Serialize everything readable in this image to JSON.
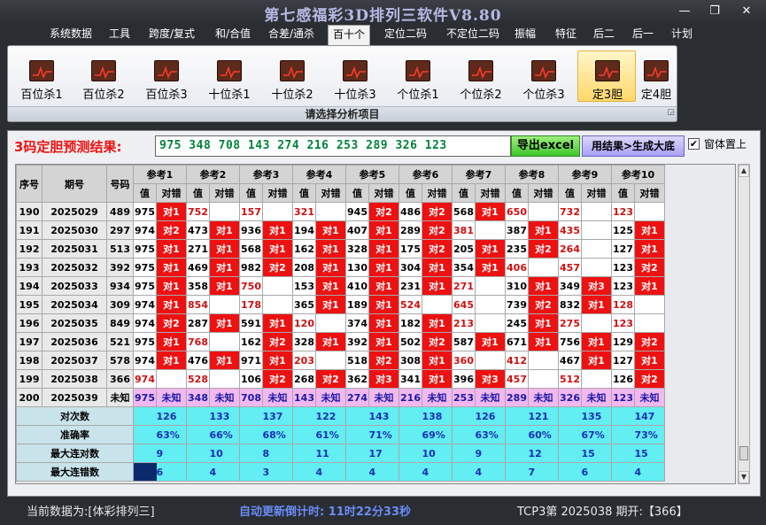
{
  "window": {
    "title": "第七感福彩3D排列三软件V8.80",
    "min_label": "—",
    "max_label": "❐",
    "close_label": "✕"
  },
  "menu": [
    "系统数据",
    "工具",
    "跨度/复式",
    "和/合值",
    "合差/通杀",
    "百十个",
    "定位二码",
    "不定位二码",
    "振幅",
    "特征",
    "后二",
    "后一",
    "计划"
  ],
  "menu_active": "百十个",
  "ribbon": {
    "buttons": [
      "百位杀1",
      "百位杀2",
      "百位杀3",
      "十位杀1",
      "十位杀2",
      "十位杀3",
      "个位杀1",
      "个位杀2",
      "个位杀3",
      "定3胆",
      "定4胆"
    ],
    "selected": "定3胆",
    "footer": "请选择分析项目",
    "icon": "red-line-chart-icon"
  },
  "result": {
    "label": "3码定胆预测结果:",
    "value": "975 348 708 143 274 216 253 289 326 123",
    "export_label": "导出excel",
    "generate_label": "用结果>生成大底",
    "topmost_label": "窗体置上",
    "topmost_checked": true
  },
  "table": {
    "headers": {
      "seq": "序号",
      "period": "期号",
      "number": "号码",
      "value": "值",
      "check": "对错"
    },
    "refs": [
      "参考1",
      "参考2",
      "参考3",
      "参考4",
      "参考5",
      "参考6",
      "参考7",
      "参考8",
      "参考9",
      "参考10"
    ],
    "rows": [
      {
        "seq": "190",
        "period": "2025029",
        "num": "489",
        "cells": [
          [
            "975",
            "对1"
          ],
          [
            "752",
            ""
          ],
          [
            "157",
            ""
          ],
          [
            "321",
            ""
          ],
          [
            "945",
            "对2"
          ],
          [
            "486",
            "对2"
          ],
          [
            "568",
            "对1"
          ],
          [
            "650",
            ""
          ],
          [
            "732",
            ""
          ],
          [
            "123",
            ""
          ]
        ]
      },
      {
        "seq": "191",
        "period": "2025030",
        "num": "297",
        "cells": [
          [
            "974",
            "对2"
          ],
          [
            "473",
            "对1"
          ],
          [
            "936",
            "对1"
          ],
          [
            "194",
            "对1"
          ],
          [
            "407",
            "对1"
          ],
          [
            "289",
            "对2"
          ],
          [
            "381",
            ""
          ],
          [
            "387",
            "对1"
          ],
          [
            "435",
            ""
          ],
          [
            "125",
            "对1"
          ]
        ]
      },
      {
        "seq": "192",
        "period": "2025031",
        "num": "513",
        "cells": [
          [
            "975",
            "对1"
          ],
          [
            "271",
            "对1"
          ],
          [
            "568",
            "对1"
          ],
          [
            "162",
            "对1"
          ],
          [
            "328",
            "对1"
          ],
          [
            "175",
            "对2"
          ],
          [
            "205",
            "对1"
          ],
          [
            "235",
            "对2"
          ],
          [
            "264",
            ""
          ],
          [
            "127",
            "对1"
          ]
        ]
      },
      {
        "seq": "193",
        "period": "2025032",
        "num": "392",
        "cells": [
          [
            "975",
            "对1"
          ],
          [
            "469",
            "对1"
          ],
          [
            "982",
            "对2"
          ],
          [
            "208",
            "对1"
          ],
          [
            "130",
            "对1"
          ],
          [
            "304",
            "对1"
          ],
          [
            "354",
            "对1"
          ],
          [
            "406",
            ""
          ],
          [
            "457",
            ""
          ],
          [
            "123",
            "对2"
          ]
        ]
      },
      {
        "seq": "194",
        "period": "2025033",
        "num": "934",
        "cells": [
          [
            "975",
            "对1"
          ],
          [
            "358",
            "对1"
          ],
          [
            "750",
            ""
          ],
          [
            "153",
            "对1"
          ],
          [
            "410",
            "对1"
          ],
          [
            "231",
            "对1"
          ],
          [
            "271",
            ""
          ],
          [
            "310",
            "对1"
          ],
          [
            "349",
            "对3"
          ],
          [
            "123",
            "对1"
          ]
        ]
      },
      {
        "seq": "195",
        "period": "2025034",
        "num": "309",
        "cells": [
          [
            "974",
            "对1"
          ],
          [
            "854",
            ""
          ],
          [
            "178",
            ""
          ],
          [
            "365",
            "对1"
          ],
          [
            "189",
            "对1"
          ],
          [
            "524",
            ""
          ],
          [
            "645",
            ""
          ],
          [
            "739",
            "对2"
          ],
          [
            "832",
            "对1"
          ],
          [
            "128",
            ""
          ]
        ]
      },
      {
        "seq": "196",
        "period": "2025035",
        "num": "849",
        "cells": [
          [
            "974",
            "对2"
          ],
          [
            "287",
            "对1"
          ],
          [
            "591",
            "对1"
          ],
          [
            "120",
            ""
          ],
          [
            "374",
            "对1"
          ],
          [
            "182",
            "对1"
          ],
          [
            "213",
            ""
          ],
          [
            "245",
            "对1"
          ],
          [
            "275",
            ""
          ],
          [
            "123",
            ""
          ]
        ]
      },
      {
        "seq": "197",
        "period": "2025036",
        "num": "521",
        "cells": [
          [
            "975",
            "对1"
          ],
          [
            "768",
            ""
          ],
          [
            "162",
            "对2"
          ],
          [
            "328",
            "对1"
          ],
          [
            "392",
            "对1"
          ],
          [
            "502",
            "对2"
          ],
          [
            "587",
            "对1"
          ],
          [
            "671",
            "对1"
          ],
          [
            "756",
            "对1"
          ],
          [
            "129",
            "对2"
          ]
        ]
      },
      {
        "seq": "198",
        "period": "2025037",
        "num": "578",
        "cells": [
          [
            "974",
            "对1"
          ],
          [
            "476",
            "对1"
          ],
          [
            "971",
            "对1"
          ],
          [
            "203",
            ""
          ],
          [
            "518",
            "对2"
          ],
          [
            "308",
            "对1"
          ],
          [
            "360",
            ""
          ],
          [
            "412",
            ""
          ],
          [
            "467",
            "对1"
          ],
          [
            "127",
            "对1"
          ]
        ]
      },
      {
        "seq": "199",
        "period": "2025038",
        "num": "366",
        "cells": [
          [
            "974",
            ""
          ],
          [
            "528",
            ""
          ],
          [
            "106",
            "对2"
          ],
          [
            "268",
            "对2"
          ],
          [
            "362",
            "对3"
          ],
          [
            "341",
            "对1"
          ],
          [
            "396",
            "对3"
          ],
          [
            "457",
            ""
          ],
          [
            "512",
            ""
          ],
          [
            "126",
            "对2"
          ]
        ]
      }
    ],
    "predict": {
      "seq": "200",
      "period": "2025039",
      "num": "未知",
      "cells": [
        [
          "975",
          "未知"
        ],
        [
          "348",
          "未知"
        ],
        [
          "708",
          "未知"
        ],
        [
          "143",
          "未知"
        ],
        [
          "274",
          "未知"
        ],
        [
          "216",
          "未知"
        ],
        [
          "253",
          "未知"
        ],
        [
          "289",
          "未知"
        ],
        [
          "326",
          "未知"
        ],
        [
          "123",
          "未知"
        ]
      ]
    },
    "stats": [
      {
        "label": "对次数",
        "values": [
          "126",
          "133",
          "137",
          "122",
          "143",
          "138",
          "126",
          "121",
          "135",
          "147"
        ]
      },
      {
        "label": "准确率",
        "values": [
          "63%",
          "66%",
          "68%",
          "61%",
          "71%",
          "69%",
          "63%",
          "60%",
          "67%",
          "73%"
        ]
      },
      {
        "label": "最大连对数",
        "values": [
          "9",
          "10",
          "8",
          "11",
          "17",
          "10",
          "9",
          "12",
          "15",
          "15"
        ]
      },
      {
        "label": "最大连错数",
        "values": [
          "6",
          "4",
          "3",
          "4",
          "4",
          "4",
          "4",
          "7",
          "6",
          "4"
        ]
      }
    ]
  },
  "status": {
    "data_source": "当前数据为:[体彩排列三]",
    "countdown": "自动更新倒计时: 11时22分33秒",
    "draw_info": "TCP3第 2025038 期开:【366】"
  }
}
